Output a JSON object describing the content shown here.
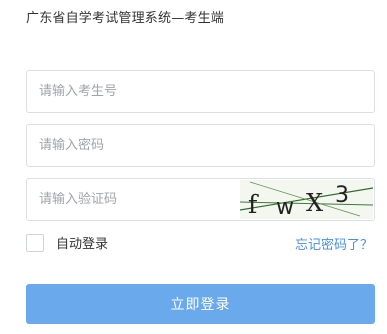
{
  "header": {
    "title": "广东省自学考试管理系统—考生端"
  },
  "form": {
    "exam_no": {
      "value": "",
      "placeholder": "请输入考生号"
    },
    "password": {
      "value": "",
      "placeholder": "请输入密码"
    },
    "captcha": {
      "value": "",
      "placeholder": "请输入验证码",
      "image_text": "fwX3"
    },
    "remember_label": "自动登录",
    "remember_checked": false,
    "forgot_label": "忘记密码了？",
    "submit_label": "立即登录"
  },
  "colors": {
    "accent": "#4a90e2",
    "button_bg": "#6aa9ec",
    "border": "#dcdfe6",
    "placeholder": "#a0a4ab"
  }
}
